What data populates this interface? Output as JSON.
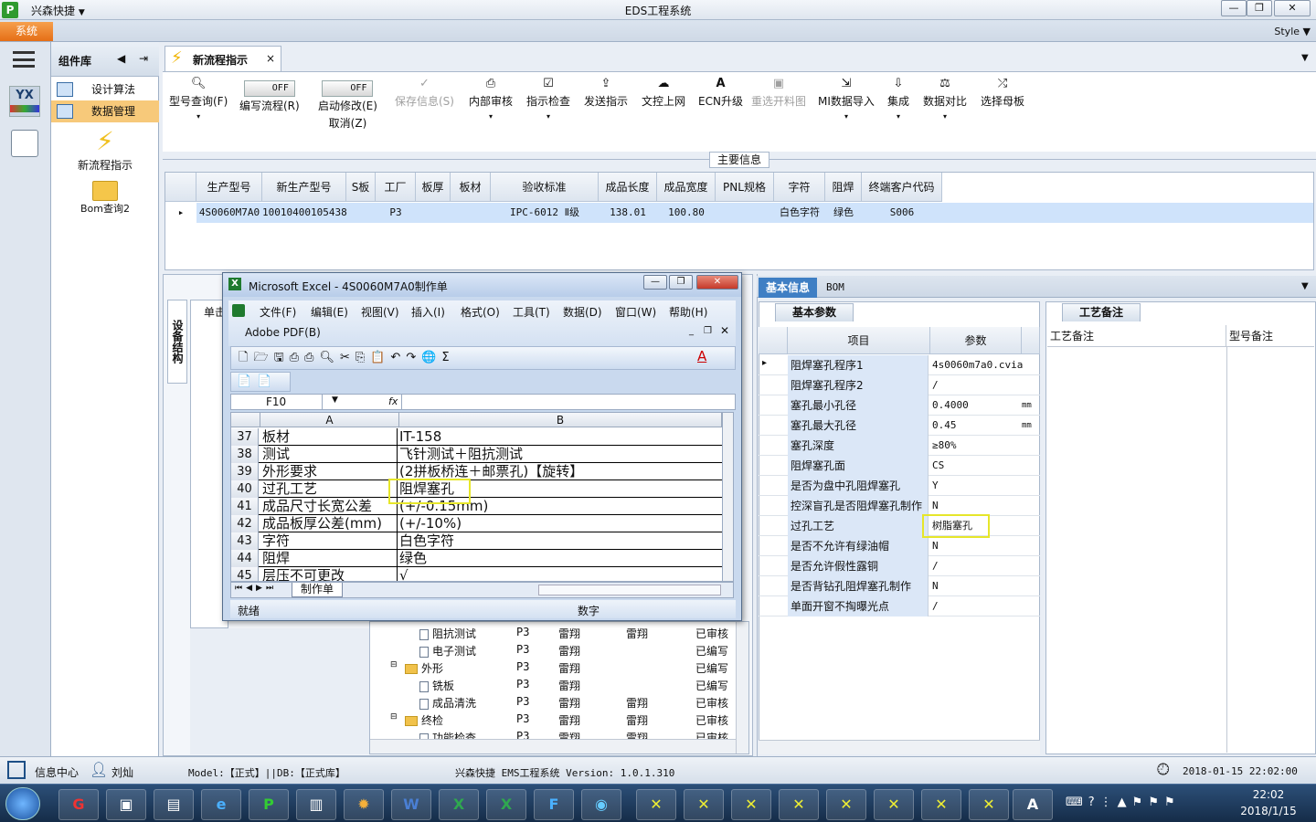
{
  "window": {
    "app_icon": "P",
    "quick_access": "兴森快捷",
    "title": "EDS工程系统",
    "style_label": "Style",
    "system_tab": "系统"
  },
  "component_panel": {
    "title": "组件库",
    "items": [
      {
        "label": "设计算法",
        "icon": "form-icon"
      },
      {
        "label": "数据管理",
        "icon": "form-icon",
        "selected": true
      },
      {
        "label": "新流程指示",
        "icon": "lightning-icon"
      },
      {
        "label": "Bom查询2",
        "icon": "folder-icon"
      }
    ]
  },
  "doc_tab": {
    "label": "新流程指示",
    "close": "×"
  },
  "ribbon": {
    "buttons": [
      {
        "label": "型号查询(F)",
        "icon": "search-icon",
        "enabled": true
      },
      {
        "label": "编写流程(R)",
        "toggle": "OFF",
        "enabled": true
      },
      {
        "label": "启动修改(E)",
        "sub": "取消(Z)",
        "toggle": "OFF",
        "enabled": true
      },
      {
        "label": "保存信息(S)",
        "icon": "check-icon",
        "enabled": false
      },
      {
        "label": "内部审核",
        "icon": "printer-icon",
        "enabled": true
      },
      {
        "label": "指示检查",
        "icon": "checkbox-icon",
        "enabled": true
      },
      {
        "label": "发送指示",
        "icon": "upload-icon",
        "enabled": true
      },
      {
        "label": "文控上网",
        "icon": "cloud-upload-icon",
        "enabled": true
      },
      {
        "label": "ECN升级",
        "icon": "ecn-icon",
        "enabled": true
      },
      {
        "label": "重选开料图",
        "icon": "image-icon",
        "enabled": false
      },
      {
        "label": "MI数据导入",
        "icon": "import-icon",
        "enabled": true
      },
      {
        "label": "集成",
        "icon": "download-icon",
        "enabled": true
      },
      {
        "label": "数据对比",
        "icon": "compare-icon",
        "enabled": true
      },
      {
        "label": "选择母板",
        "icon": "shuffle-icon",
        "enabled": true
      }
    ],
    "group_label": "主要信息"
  },
  "main_grid": {
    "headers": [
      "生产型号",
      "新生产型号",
      "S板",
      "工厂",
      "板厚",
      "板材",
      "验收标准",
      "成品长度",
      "成品宽度",
      "PNL规格",
      "字符",
      "阻焊",
      "终端客户代码"
    ],
    "row": [
      "4S0060M7A0",
      "10010400105438",
      "",
      "P3",
      "",
      "",
      "IPC-6012 Ⅱ级",
      "138.01",
      "100.80",
      "",
      "白色字符",
      "绿色",
      "S006"
    ]
  },
  "left_panel": {
    "vertical_tab": "设备结构",
    "partial_tab": "单击"
  },
  "tree_rows": [
    {
      "indent": 1,
      "type": "doc",
      "name": "阻抗测试",
      "factory": "P3",
      "c1": "雷翔",
      "c2": "雷翔",
      "status": "已审核"
    },
    {
      "indent": 1,
      "type": "doc",
      "name": "电子测试",
      "factory": "P3",
      "c1": "雷翔",
      "c2": "",
      "status": "已编写"
    },
    {
      "indent": 0,
      "type": "folder",
      "name": "外形",
      "factory": "P3",
      "c1": "雷翔",
      "c2": "",
      "status": "已编写"
    },
    {
      "indent": 1,
      "type": "doc",
      "name": "铣板",
      "factory": "P3",
      "c1": "雷翔",
      "c2": "",
      "status": "已编写"
    },
    {
      "indent": 1,
      "type": "doc",
      "name": "成品清洗",
      "factory": "P3",
      "c1": "雷翔",
      "c2": "雷翔",
      "status": "已审核"
    },
    {
      "indent": 0,
      "type": "folder",
      "name": "终检",
      "factory": "P3",
      "c1": "雷翔",
      "c2": "雷翔",
      "status": "已审核"
    },
    {
      "indent": 1,
      "type": "doc",
      "name": "功能检查",
      "factory": "P3",
      "c1": "雷翔",
      "c2": "雷翔",
      "status": "已审核"
    }
  ],
  "right_panel": {
    "tab_basic": "基本信息",
    "tab_bom": "BOM",
    "param_tab": "基本参数",
    "param_headers": [
      "项目",
      "参数"
    ],
    "params": [
      {
        "item": "阻焊塞孔程序1",
        "value": "4s0060m7a0.cvia",
        "unit": ""
      },
      {
        "item": "阻焊塞孔程序2",
        "value": "/",
        "unit": ""
      },
      {
        "item": "塞孔最小孔径",
        "value": "0.4000",
        "unit": "mm"
      },
      {
        "item": "塞孔最大孔径",
        "value": "0.45",
        "unit": "mm"
      },
      {
        "item": "塞孔深度",
        "value": "≥80%",
        "unit": ""
      },
      {
        "item": "阻焊塞孔面",
        "value": "CS",
        "unit": ""
      },
      {
        "item": "是否为盘中孔阻焊塞孔",
        "value": "Y",
        "unit": ""
      },
      {
        "item": "控深盲孔是否阻焊塞孔制作",
        "value": "N",
        "unit": ""
      },
      {
        "item": "过孔工艺",
        "value": "树脂塞孔",
        "unit": "",
        "highlight": true
      },
      {
        "item": "是否不允许有绿油帽",
        "value": "N",
        "unit": ""
      },
      {
        "item": "是否允许假性露铜",
        "value": "/",
        "unit": ""
      },
      {
        "item": "是否背钻孔阻焊塞孔制作",
        "value": "N",
        "unit": ""
      },
      {
        "item": "单面开窗不掏曝光点",
        "value": "/",
        "unit": ""
      }
    ],
    "remark_tab": "工艺备注",
    "remark_headers": [
      "工艺备注",
      "型号备注"
    ]
  },
  "excel": {
    "title": "Microsoft Excel - 4S0060M7A0制作单",
    "menus": [
      "文件(F)",
      "编辑(E)",
      "视图(V)",
      "插入(I)",
      "格式(O)",
      "工具(T)",
      "数据(D)",
      "窗口(W)",
      "帮助(H)"
    ],
    "menu2": "Adobe PDF(B)",
    "name_box": "F10",
    "fx": "fx",
    "col_a": "A",
    "col_b": "B",
    "rows": [
      {
        "n": "37",
        "a": "板材",
        "b": "IT-158"
      },
      {
        "n": "38",
        "a": "测试",
        "b": "飞针测试＋阻抗测试"
      },
      {
        "n": "39",
        "a": "外形要求",
        "b": "(2拼板桥连＋邮票孔)【旋转】"
      },
      {
        "n": "40",
        "a": "过孔工艺",
        "b": "阻焊塞孔",
        "highlight": true
      },
      {
        "n": "41",
        "a": "成品尺寸长宽公差",
        "b": "(+/-0.15mm)"
      },
      {
        "n": "42",
        "a": "成品板厚公差(mm)",
        "b": "(+/-10%)"
      },
      {
        "n": "43",
        "a": "字符",
        "b": "白色字符"
      },
      {
        "n": "44",
        "a": "阻焊",
        "b": "绿色"
      },
      {
        "n": "45",
        "a": "层压不可更改",
        "b": "√"
      }
    ],
    "sheet_tab": "制作单",
    "status_ready": "就绪",
    "status_num": "数字"
  },
  "status_bar": {
    "info_center": "信息中心",
    "user": "刘灿",
    "model_db": "Model:【正式】||DB:【正式库】",
    "app_version": "兴森快捷 EMS工程系统 Version: 1.0.1.310",
    "datetime": "2018-01-15 22:02:00"
  },
  "taskbar": {
    "time": "22:02",
    "date": "2018/1/15"
  }
}
